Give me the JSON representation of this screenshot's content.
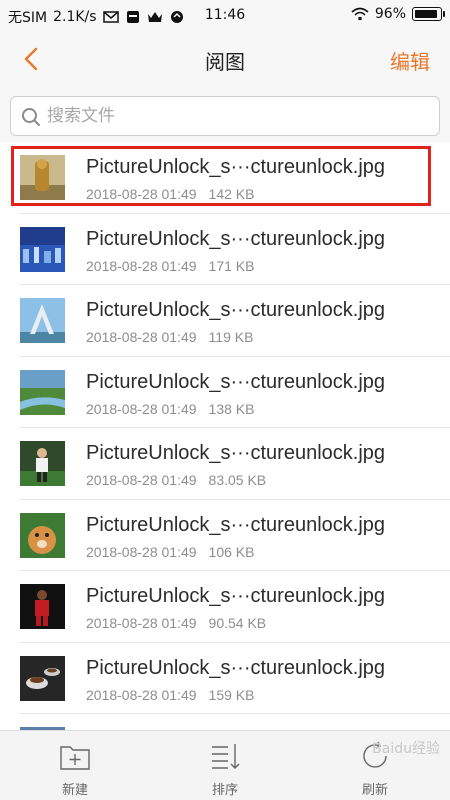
{
  "status_bar": {
    "carrier": "无SIM",
    "speed": "2.1K/s",
    "time": "11:46",
    "battery": "96%",
    "battery_level": 0.96
  },
  "header": {
    "title": "阅图",
    "edit_label": "编辑",
    "accent_color": "#e9782d"
  },
  "search": {
    "placeholder": "搜索文件"
  },
  "files": [
    {
      "name": "PictureUnlock_s···ctureunlock.jpg",
      "date": "2018-08-28 01:49",
      "size": "142 KB",
      "thumb": "golden-statue"
    },
    {
      "name": "PictureUnlock_s···ctureunlock.jpg",
      "date": "2018-08-28 01:49",
      "size": "171 KB",
      "thumb": "city-night"
    },
    {
      "name": "PictureUnlock_s···ctureunlock.jpg",
      "date": "2018-08-28 01:49",
      "size": "119 KB",
      "thumb": "tower-monument"
    },
    {
      "name": "PictureUnlock_s···ctureunlock.jpg",
      "date": "2018-08-28 01:49",
      "size": "138 KB",
      "thumb": "river-landscape"
    },
    {
      "name": "PictureUnlock_s···ctureunlock.jpg",
      "date": "2018-08-28 01:49",
      "size": "83.05 KB",
      "thumb": "soccer-player"
    },
    {
      "name": "PictureUnlock_s···ctureunlock.jpg",
      "date": "2018-08-28 01:49",
      "size": "106 KB",
      "thumb": "dog"
    },
    {
      "name": "PictureUnlock_s···ctureunlock.jpg",
      "date": "2018-08-28 01:49",
      "size": "90.54 KB",
      "thumb": "basketball-player"
    },
    {
      "name": "PictureUnlock_s···ctureunlock.jpg",
      "date": "2018-08-28 01:49",
      "size": "159 KB",
      "thumb": "coffee-cups"
    }
  ],
  "bottom_bar": {
    "new_label": "新建",
    "sort_label": "排序",
    "refresh_label": "刷新"
  },
  "watermark": "Baidu经验",
  "highlight_color": "#e0221b"
}
